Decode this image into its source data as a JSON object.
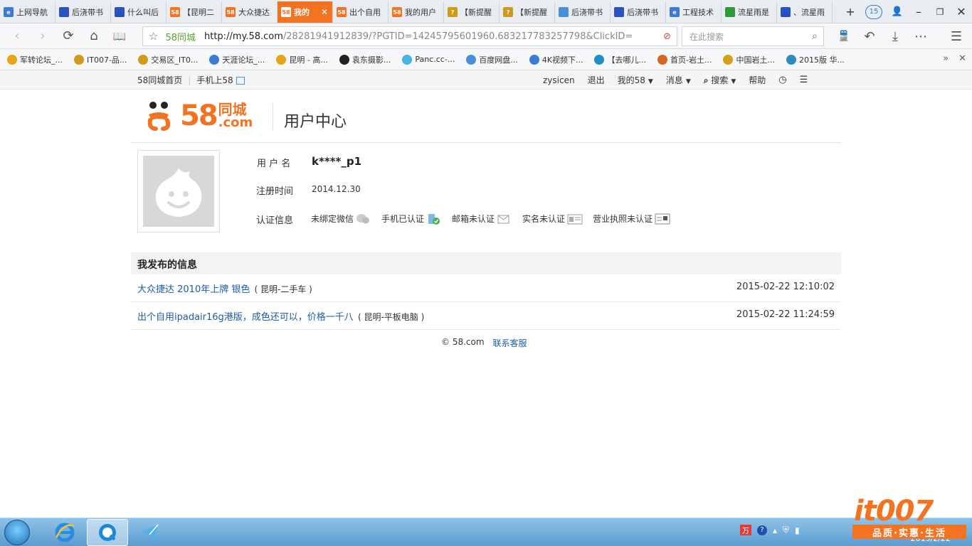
{
  "browser": {
    "tabs": [
      {
        "label": "上网导航",
        "icon": "globe-icon",
        "color": "#3a7bd5",
        "glyph": "e"
      },
      {
        "label": "后浇带书",
        "icon": "page-icon",
        "color": "#2a52be",
        "glyph": ""
      },
      {
        "label": "什么叫后",
        "icon": "page-icon",
        "color": "#2a52be",
        "glyph": ""
      },
      {
        "label": "【昆明二",
        "icon": "58-icon",
        "color": "#f47320",
        "glyph": "58"
      },
      {
        "label": "大众捷达",
        "icon": "58-icon",
        "color": "#f47320",
        "glyph": "58"
      },
      {
        "label": "我的",
        "icon": "58-icon",
        "color": "#f47320",
        "glyph": "58",
        "active": true
      },
      {
        "label": "出个自用",
        "icon": "58-icon",
        "color": "#f47320",
        "glyph": "58"
      },
      {
        "label": "我的用户",
        "icon": "58-icon",
        "color": "#f47320",
        "glyph": "58"
      },
      {
        "label": "【新提醒",
        "icon": "it007-icon",
        "color": "#d19a1a",
        "glyph": "?"
      },
      {
        "label": "【新提醒",
        "icon": "it007-icon",
        "color": "#d19a1a",
        "glyph": "?"
      },
      {
        "label": "后浇带书",
        "icon": "doc-icon",
        "color": "#4a90d9",
        "glyph": ""
      },
      {
        "label": "后浇带书",
        "icon": "page-icon",
        "color": "#2a52be",
        "glyph": ""
      },
      {
        "label": "工程技术",
        "icon": "globe-icon",
        "color": "#3a7bd5",
        "glyph": "e"
      },
      {
        "label": "流星雨是",
        "icon": "map-icon",
        "color": "#2f9a3a",
        "glyph": ""
      },
      {
        "label": "、流星雨",
        "icon": "page-icon",
        "color": "#2a52be",
        "glyph": ""
      }
    ],
    "tab_count": "15",
    "address": {
      "site_label": "58同城",
      "url_host": "http://my.58.com",
      "url_rest": "/28281941912839/?PGTID=14245795601960.683217783257798&ClickID="
    },
    "search_placeholder": "在此搜索",
    "bookmarks": [
      {
        "label": "军转论坛_...",
        "color": "#e8a317"
      },
      {
        "label": "IT007-品...",
        "color": "#d19a1a"
      },
      {
        "label": "交易区_IT0...",
        "color": "#d19a1a"
      },
      {
        "label": "天涯论坛_...",
        "color": "#3a7bd5"
      },
      {
        "label": "昆明 - 高...",
        "color": "#e8a317"
      },
      {
        "label": "袁东摄影...",
        "color": "#222222"
      },
      {
        "label": "Panc.cc-...",
        "color": "#4ab3e8"
      },
      {
        "label": "百度网盘...",
        "color": "#4a90d9"
      },
      {
        "label": "4K视频下...",
        "color": "#3a7bd5"
      },
      {
        "label": "【去哪儿...",
        "color": "#1e90c8"
      },
      {
        "label": "首页-岩土...",
        "color": "#d2691e"
      },
      {
        "label": "中国岩土...",
        "color": "#d4a017"
      },
      {
        "label": "2015版 华...",
        "color": "#2e8bc0"
      }
    ]
  },
  "site_nav": {
    "home": "58同城首页",
    "mobile": "手机上58",
    "user": "zysicen",
    "logout": "退出",
    "my58": "我的58",
    "messages": "消息",
    "search": "搜索",
    "help": "帮助"
  },
  "logo": {
    "num": "58",
    "cn": "同城",
    "com": ".com"
  },
  "page_title": "用户中心",
  "profile": {
    "username_label": "用 户 名",
    "username": "k****_p1",
    "regdate_label": "注册时间",
    "regdate": "2014.12.30",
    "verify_label": "认证信息",
    "verifications": [
      {
        "label": "未绑定微信",
        "icon": "wechat-icon"
      },
      {
        "label": "手机已认证",
        "icon": "phone-verified-icon"
      },
      {
        "label": "邮箱未认证",
        "icon": "email-icon"
      },
      {
        "label": "实名未认证",
        "icon": "id-card-icon"
      },
      {
        "label": "营业执照未认证",
        "icon": "license-icon"
      }
    ]
  },
  "posts": {
    "header": "我发布的信息",
    "items": [
      {
        "title": "大众捷达 2010年上牌 银色",
        "category": "( 昆明-二手车 )",
        "date": "2015-02-22 12:10:02"
      },
      {
        "title": "出个自用ipadair16g港版，成色还可以，价格一千八",
        "category": "( 昆明-平板电脑 )",
        "date": "2015-02-22 11:24:59"
      }
    ]
  },
  "footer": {
    "copyright": "© 58.com",
    "contact": "联系客服"
  },
  "taskbar": {
    "date": "2015/2/22"
  },
  "watermark": {
    "text": "it007",
    "sub": "品质·实惠·生活"
  },
  "colors": {
    "brand": "#f47320",
    "link": "#1b5ea9"
  }
}
